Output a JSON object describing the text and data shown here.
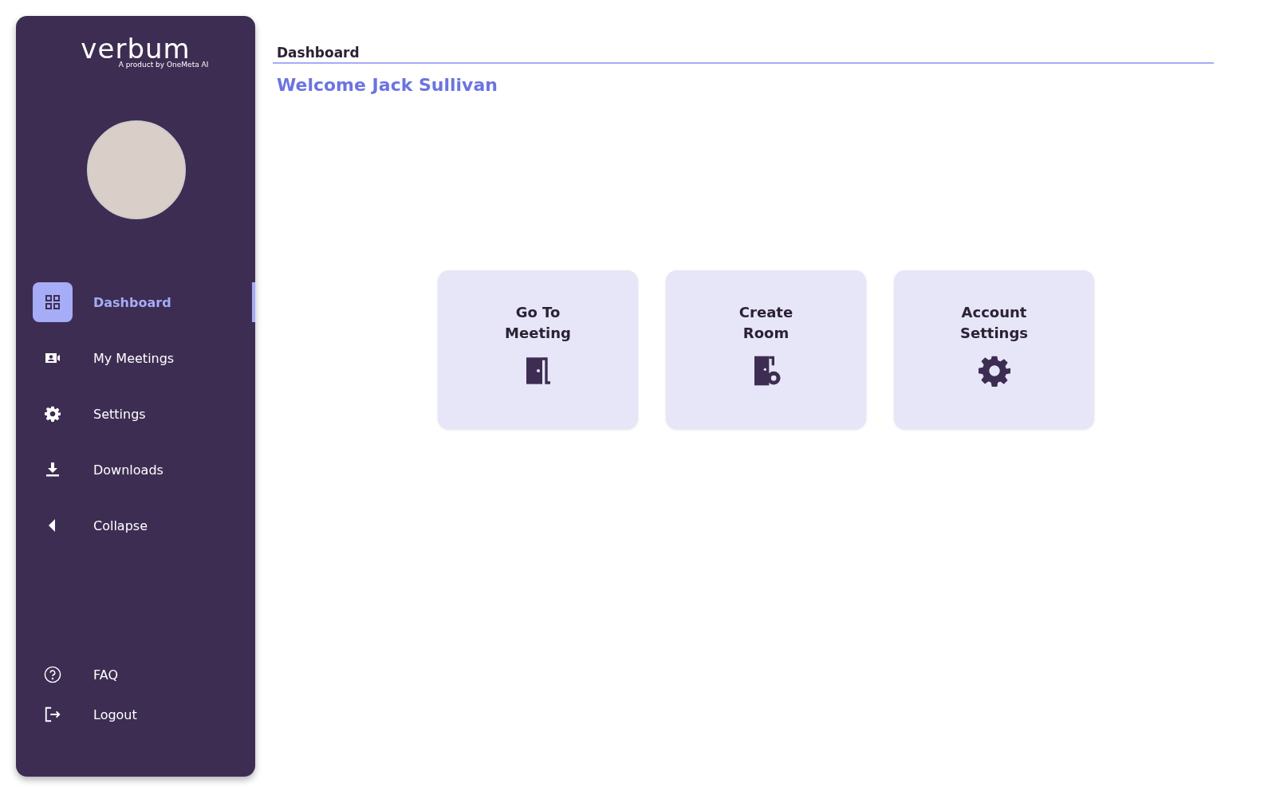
{
  "brand": {
    "name": "verbum",
    "tagline": "A product by OneMeta AI"
  },
  "nav": [
    {
      "label": "Dashboard",
      "kind": "grid",
      "selected": true
    },
    {
      "label": "My Meetings",
      "kind": "video",
      "selected": false
    },
    {
      "label": "Settings",
      "kind": "gear",
      "selected": false
    },
    {
      "label": "Downloads",
      "kind": "download",
      "selected": false
    },
    {
      "label": "Collapse",
      "kind": "caret",
      "selected": false
    }
  ],
  "footer_nav": [
    {
      "label": "FAQ",
      "kind": "help"
    },
    {
      "label": "Logout",
      "kind": "logout"
    }
  ],
  "header": {
    "title": "Dashboard",
    "welcome": "Welcome Jack Sullivan"
  },
  "cards": [
    {
      "lines": [
        "Go To",
        "Meeting"
      ],
      "kind": "door"
    },
    {
      "lines": [
        "Create",
        "Room"
      ],
      "kind": "door-gear"
    },
    {
      "lines": [
        "Account",
        "Settings"
      ],
      "kind": "gear"
    }
  ]
}
